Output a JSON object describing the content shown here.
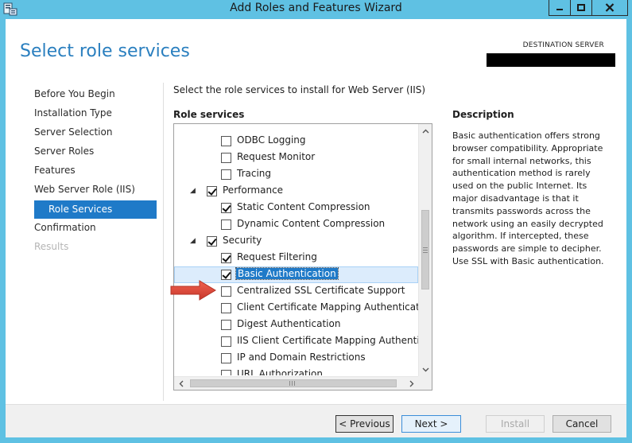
{
  "window": {
    "title": "Add Roles and Features Wizard",
    "controls": [
      "minimize-icon",
      "maximize-icon",
      "close-icon"
    ]
  },
  "page": {
    "title": "Select role services",
    "destination_label": "DESTINATION SERVER",
    "destination_value": ""
  },
  "nav": {
    "items": [
      {
        "label": "Before You Begin",
        "state": "normal"
      },
      {
        "label": "Installation Type",
        "state": "normal"
      },
      {
        "label": "Server Selection",
        "state": "normal"
      },
      {
        "label": "Server Roles",
        "state": "normal"
      },
      {
        "label": "Features",
        "state": "normal"
      },
      {
        "label": "Web Server Role (IIS)",
        "state": "normal"
      },
      {
        "label": "Role Services",
        "state": "active"
      },
      {
        "label": "Confirmation",
        "state": "normal"
      },
      {
        "label": "Results",
        "state": "disabled"
      }
    ]
  },
  "main": {
    "instruction": "Select the role services to install for Web Server (IIS)",
    "role_services_header": "Role services",
    "tree": [
      {
        "label": "ODBC Logging",
        "checked": false,
        "level": 2,
        "expander": false,
        "selected": false
      },
      {
        "label": "Request Monitor",
        "checked": false,
        "level": 2,
        "expander": false,
        "selected": false
      },
      {
        "label": "Tracing",
        "checked": false,
        "level": 2,
        "expander": false,
        "selected": false
      },
      {
        "label": "Performance",
        "checked": true,
        "level": 1,
        "expander": true,
        "selected": false
      },
      {
        "label": "Static Content Compression",
        "checked": true,
        "level": 2,
        "expander": false,
        "selected": false
      },
      {
        "label": "Dynamic Content Compression",
        "checked": false,
        "level": 2,
        "expander": false,
        "selected": false
      },
      {
        "label": "Security",
        "checked": true,
        "level": 1,
        "expander": true,
        "selected": false
      },
      {
        "label": "Request Filtering",
        "checked": true,
        "level": 2,
        "expander": false,
        "selected": false
      },
      {
        "label": "Basic Authentication",
        "checked": true,
        "level": 2,
        "expander": false,
        "selected": true
      },
      {
        "label": "Centralized SSL Certificate Support",
        "checked": false,
        "level": 2,
        "expander": false,
        "selected": false
      },
      {
        "label": "Client Certificate Mapping Authentication",
        "checked": false,
        "level": 2,
        "expander": false,
        "selected": false
      },
      {
        "label": "Digest Authentication",
        "checked": false,
        "level": 2,
        "expander": false,
        "selected": false
      },
      {
        "label": "IIS Client Certificate Mapping Authenticatio",
        "checked": false,
        "level": 2,
        "expander": false,
        "selected": false
      },
      {
        "label": "IP and Domain Restrictions",
        "checked": false,
        "level": 2,
        "expander": false,
        "selected": false
      },
      {
        "label": "URL Authorization",
        "checked": false,
        "level": 2,
        "expander": false,
        "selected": false
      }
    ],
    "description_header": "Description",
    "description_text": "Basic authentication offers strong browser compatibility. Appropriate for small internal networks, this authentication method is rarely used on the public Internet. Its major disadvantage is that it transmits passwords across the network using an easily decrypted algorithm. If intercepted, these passwords are simple to decipher. Use SSL with Basic authentication."
  },
  "footer": {
    "previous_label": "< Previous",
    "next_label": "Next >",
    "install_label": "Install",
    "cancel_label": "Cancel"
  },
  "colors": {
    "frame": "#5fc1e3",
    "accent": "#1f7ac8",
    "title": "#2a7fbf",
    "annotation_arrow": "#e0463a"
  }
}
